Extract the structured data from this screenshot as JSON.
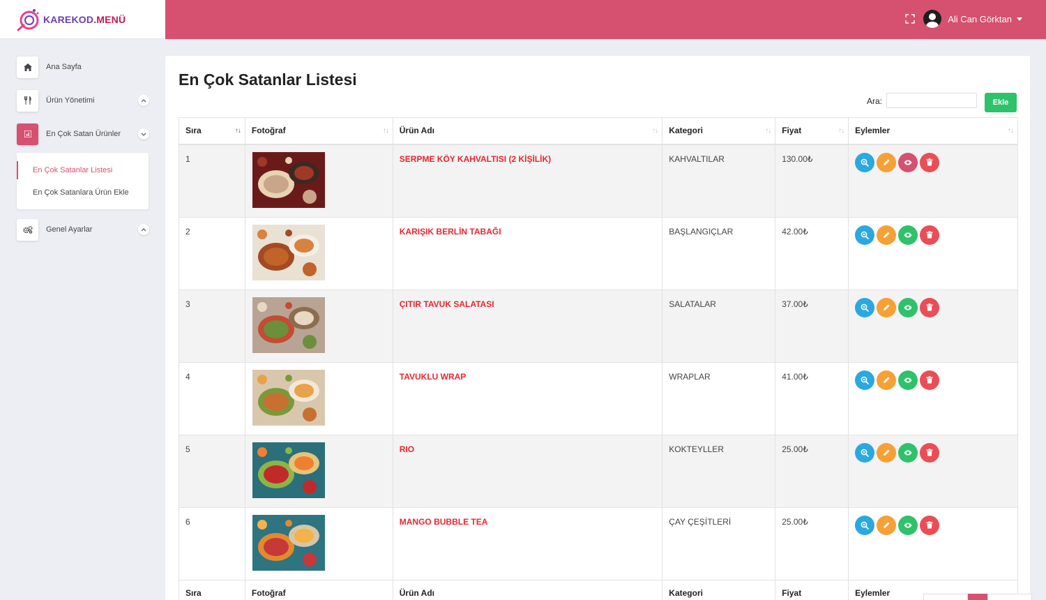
{
  "brand": {
    "name": "KAREKOD.MENÜ",
    "first": "KAREKOD",
    "rest": ".MENÜ"
  },
  "header": {
    "user_name": "Ali Can Görktan",
    "fullscreen_icon": "fullscreen-icon",
    "dropdown_icon": "caret-down-icon"
  },
  "sidebar": {
    "items": [
      {
        "label": "Ana Sayfa",
        "icon": "home-icon"
      },
      {
        "label": "Ürün Yönetimi",
        "icon": "utensils-icon"
      },
      {
        "label": "En Çok Satan Ürünler",
        "icon": "chart-icon",
        "active": true
      },
      {
        "label": "Genel Ayarlar",
        "icon": "gears-icon"
      }
    ],
    "submenu": [
      {
        "label": "En Çok Satanlar Listesi",
        "active": true
      },
      {
        "label": "En Çok Satanlara Ürün Ekle"
      }
    ]
  },
  "page": {
    "title": "En Çok Satanlar Listesi",
    "search_label": "Ara:",
    "search_value": "",
    "add_label": "Ekle"
  },
  "table": {
    "headers": [
      "Sıra",
      "Fotoğraf",
      "Ürün Adı",
      "Kategori",
      "Fiyat",
      "Eylemler"
    ],
    "rows": [
      {
        "rank": "1",
        "name": "SERPME KÖY KAHVALTISI (2 KİŞİLİK)",
        "category": "KAHVALTILAR",
        "price": "130.00₺",
        "visible": false
      },
      {
        "rank": "2",
        "name": "KARIŞIK BERLİN TABAĞI",
        "category": "BAŞLANGIÇLAR",
        "price": "42.00₺",
        "visible": true
      },
      {
        "rank": "3",
        "name": "ÇITIR TAVUK SALATASI",
        "category": "SALATALAR",
        "price": "37.00₺",
        "visible": true
      },
      {
        "rank": "4",
        "name": "TAVUKLU WRAP",
        "category": "WRAPLAR",
        "price": "41.00₺",
        "visible": true
      },
      {
        "rank": "5",
        "name": "RIO",
        "category": "KOKTEYLLER",
        "price": "25.00₺",
        "visible": true
      },
      {
        "rank": "6",
        "name": "MANGO BUBBLE TEA",
        "category": "ÇAY ÇEŞİTLERİ",
        "price": "25.00₺",
        "visible": true
      }
    ]
  },
  "colors": {
    "primary": "#d6506f",
    "success": "#2ec26a",
    "info": "#2aa8e0",
    "warning": "#f7a035",
    "danger": "#ea4d55",
    "product": "#e8262f"
  }
}
